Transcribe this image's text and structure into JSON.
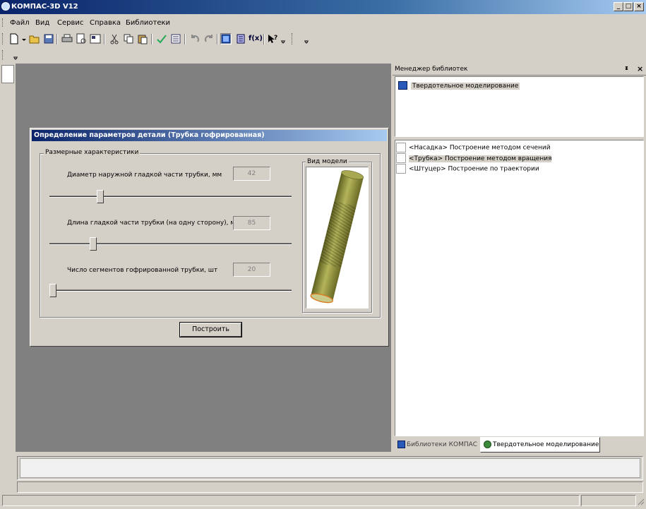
{
  "window": {
    "title": "КОМПАС-3D V12",
    "controls": [
      "_",
      "□",
      "×"
    ]
  },
  "menu": [
    {
      "label": "Файл"
    },
    {
      "label": "Вид"
    },
    {
      "label": "Сервис"
    },
    {
      "label": "Справка"
    },
    {
      "label": "Библиотеки"
    }
  ],
  "toolbar": {
    "icons": [
      "new-doc-icon",
      "open-folder-icon",
      "save-icon",
      "print-icon",
      "print-preview-icon",
      "properties-icon",
      "cut-icon",
      "copy-icon",
      "paste-icon",
      "check-icon",
      "list-icon",
      "undo-icon",
      "redo-icon",
      "tree-icon",
      "variables-icon",
      "fx-icon",
      "help-pointer-icon"
    ],
    "fx_label": "f(x)"
  },
  "library_manager": {
    "title": "Менеджер библиотек",
    "pin": "ᵻ",
    "close": "×",
    "top_item": "Твердотельное моделирование",
    "items": [
      {
        "label": "<Насадка> Построение методом сечений",
        "selected": false
      },
      {
        "label": "<Трубка>  Построение методом вращения",
        "selected": true
      },
      {
        "label": "<Штуцер>  Построение по траектории",
        "selected": false
      }
    ],
    "tabs": [
      {
        "label": "Библиотеки КОМПАС",
        "active": false
      },
      {
        "label": "Твердотельное моделирование",
        "active": true
      }
    ]
  },
  "dialog": {
    "title": "Определение параметров детали (Трубка гофрированная)",
    "group_label": "Размерные характеристики",
    "preview_label": "Вид модели",
    "params": [
      {
        "label": "Диаметр наружной гладкой части трубки, мм",
        "value": "42",
        "slider_fraction": 0.2
      },
      {
        "label": "Длина гладкой части трубки (на одну сторону), мм",
        "value": "85",
        "slider_fraction": 0.17
      },
      {
        "label": "Число сегментов гофрированной трубки, шт",
        "value": "20",
        "slider_fraction": 0.0
      }
    ],
    "build_button": "Построить"
  },
  "colors": {
    "title_gradient_start": "#0a246a",
    "title_gradient_end": "#a6caf0",
    "workspace": "#808080",
    "pipe": "#9a9a3a",
    "pipe_rim": "#d97a1e"
  }
}
